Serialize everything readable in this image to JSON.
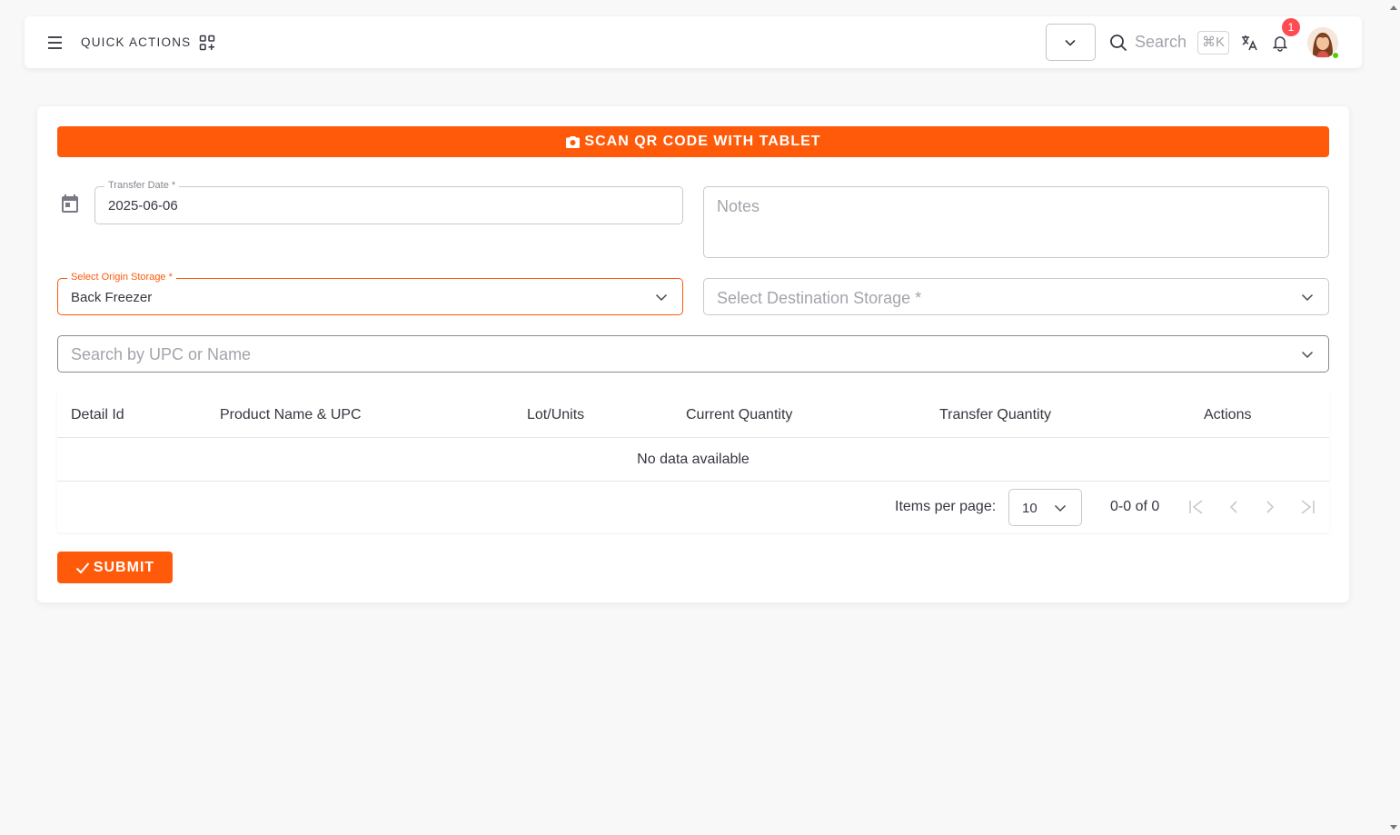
{
  "navbar": {
    "quick_actions_label": "QUICK ACTIONS",
    "search_placeholder": "Search",
    "search_shortcut": "⌘K",
    "notification_count": "1"
  },
  "form": {
    "scan_button_label": "SCAN QR CODE WITH TABLET",
    "transfer_date_label": "Transfer Date *",
    "transfer_date_value": "2025-06-06",
    "notes_placeholder": "Notes",
    "origin_label": "Select Origin Storage *",
    "origin_value": "Back Freezer",
    "destination_placeholder": "Select Destination Storage *",
    "product_search_placeholder": "Search by UPC or Name",
    "submit_label": "SUBMIT"
  },
  "table": {
    "columns": [
      "Detail Id",
      "Product Name & UPC",
      "Lot/Units",
      "Current Quantity",
      "Transfer Quantity",
      "Actions"
    ],
    "empty_text": "No data available",
    "items_per_page_label": "Items per page:",
    "items_per_page_value": "10",
    "range_text": "0-0 of 0"
  },
  "colors": {
    "accent": "#ff5a0a",
    "badge": "#ff4c51",
    "online": "#56ca00"
  }
}
